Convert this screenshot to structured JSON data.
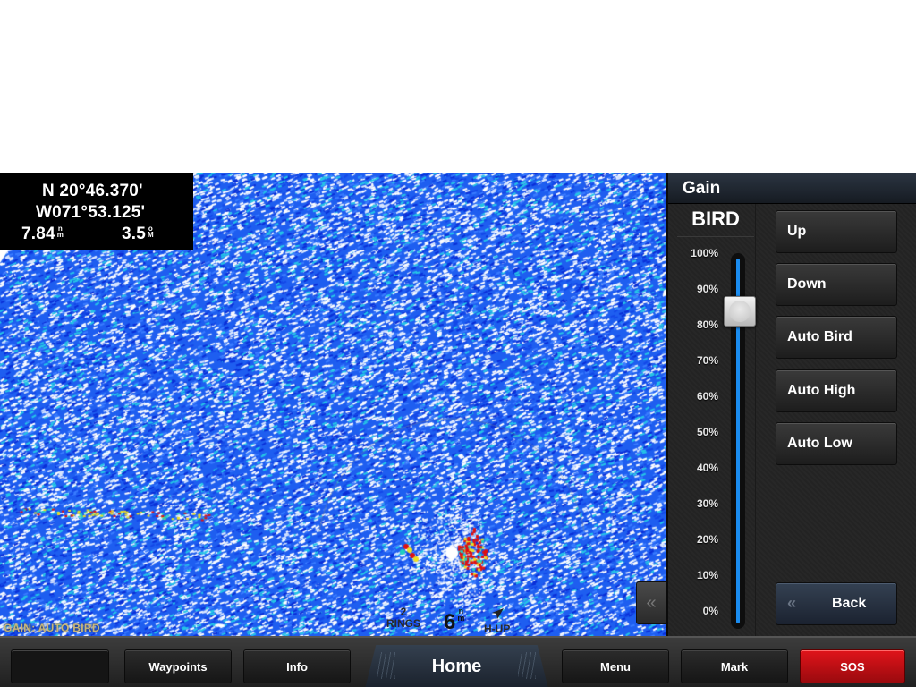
{
  "position": {
    "lat": "N  20°46.370'",
    "lon": "W071°53.125'",
    "speed": "7.84",
    "speed_unit_top": "n",
    "speed_unit_bottom": "m",
    "depth": "3.5",
    "depth_unit_top": "o",
    "depth_unit_bottom": "M"
  },
  "radar": {
    "gain_mode_label": "GAIN: AUTO BIRD",
    "rings_count": "2",
    "rings_label": "RINGS",
    "range_value": "6",
    "range_unit_top": "n",
    "range_unit_bottom": "m",
    "orientation_label": "H-UP",
    "colors": {
      "background": "#1e5ef0",
      "speckle": "#ffffff",
      "return_strong": "#e01010",
      "return_mid": "#f0e020",
      "return_weak": "#20d0c0"
    }
  },
  "panel": {
    "title": "Gain",
    "mode": "BIRD",
    "scale_ticks": [
      "100%",
      "90%",
      "80%",
      "70%",
      "60%",
      "50%",
      "40%",
      "30%",
      "20%",
      "10%",
      "0%"
    ],
    "gain_value_percent": 84,
    "buttons": [
      {
        "label": "Up"
      },
      {
        "label": "Down"
      },
      {
        "label": "Auto Bird"
      },
      {
        "label": "Auto High"
      },
      {
        "label": "Auto Low"
      }
    ],
    "back_label": "Back",
    "back_icon": "«",
    "collapse_icon": "«",
    "accent_color": "#1a8cf0"
  },
  "bottom_bar": {
    "blank_label": "",
    "waypoints_label": "Waypoints",
    "info_label": "Info",
    "home_label": "Home",
    "menu_label": "Menu",
    "mark_label": "Mark",
    "sos_label": "SOS",
    "sos_color": "#d4121a"
  }
}
